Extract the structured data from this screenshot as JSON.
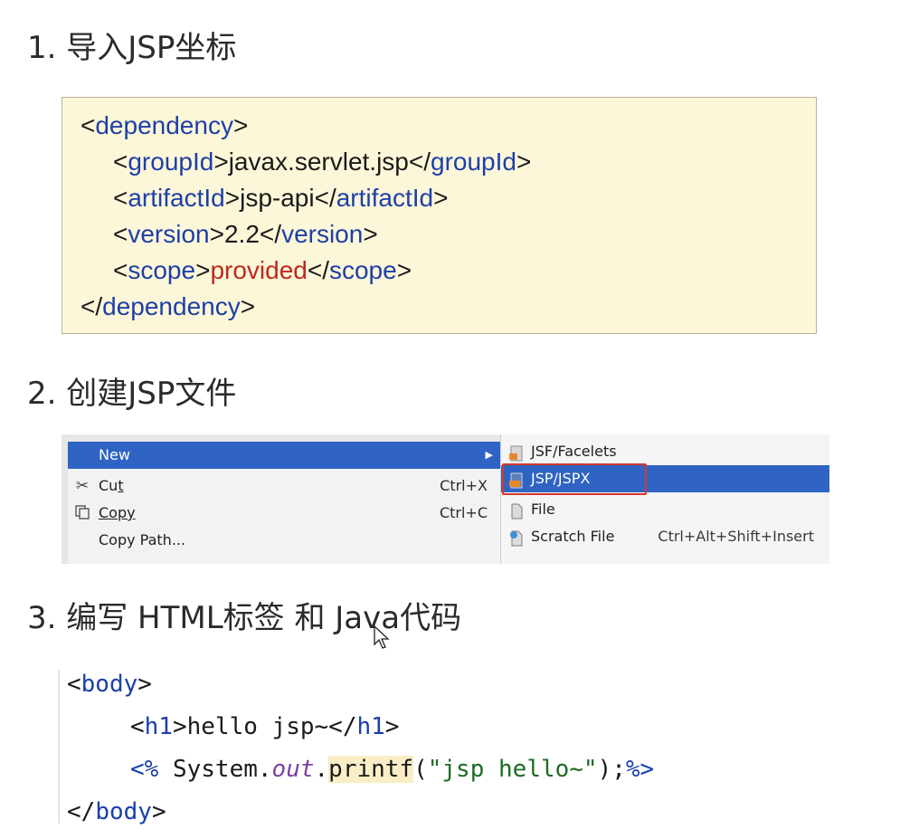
{
  "headings": {
    "step1": "1. 导入JSP坐标",
    "step2": "2. 创建JSP文件",
    "step3": "3. 编写 HTML标签 和 Java代码"
  },
  "xml": {
    "dependency_open_tag": "dependency",
    "groupId_tag": "groupId",
    "groupId_value": "javax.servlet.jsp",
    "artifactId_tag": "artifactId",
    "artifactId_value": "jsp-api",
    "version_tag": "version",
    "version_value": "2.2",
    "scope_tag": "scope",
    "scope_value": "provided"
  },
  "context_menu": {
    "items": [
      {
        "label": "New",
        "shortcut": "",
        "icon": "none",
        "selected": true
      },
      {
        "label": "Cut",
        "shortcut": "Ctrl+X",
        "icon": "scissors-icon",
        "selected": false
      },
      {
        "label": "Copy",
        "shortcut": "Ctrl+C",
        "icon": "copy-icon",
        "selected": false
      },
      {
        "label": "Copy Path...",
        "shortcut": "",
        "icon": "none",
        "selected": false
      }
    ],
    "submenu": [
      {
        "label": "JSF/Facelets",
        "shortcut": "",
        "icon": "jsf-file-icon",
        "selected": false
      },
      {
        "label": "JSP/JSPX",
        "shortcut": "",
        "icon": "jsp-file-icon",
        "selected": true
      },
      {
        "label": "File",
        "shortcut": "",
        "icon": "file-icon",
        "selected": false
      },
      {
        "label": "Scratch File",
        "shortcut": "Ctrl+Alt+Shift+Insert",
        "icon": "scratch-file-icon",
        "selected": false
      }
    ],
    "colors": {
      "selection": "#2f64c4",
      "highlight_border": "#d6382c"
    }
  },
  "code": {
    "body_tag": "body",
    "h1_tag": "h1",
    "h1_text": "hello jsp~",
    "scriptlet_open": "<%",
    "system_out": " System.",
    "out_field": "out",
    "printf_fn": "printf",
    "printf_arg": "\"jsp hello~\"",
    "scriptlet_close": "%>"
  }
}
